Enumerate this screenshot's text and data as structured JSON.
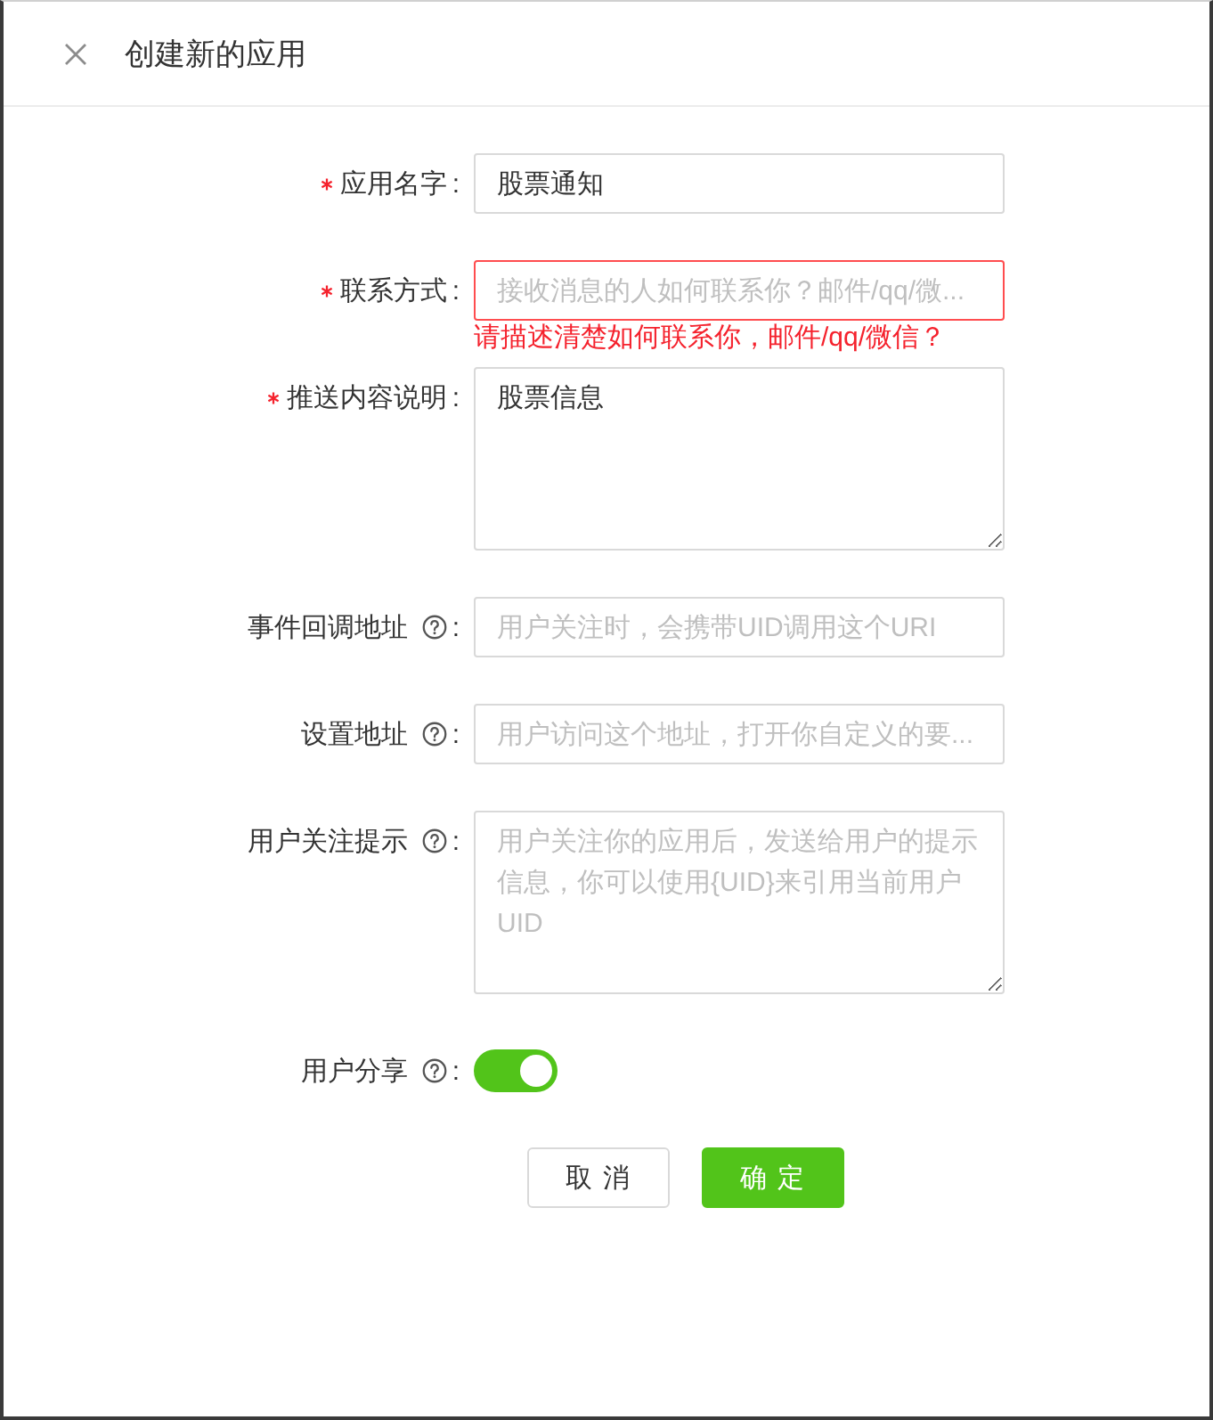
{
  "dialog": {
    "title": "创建新的应用"
  },
  "fields": [
    {
      "kind": "input",
      "label": "应用名字",
      "colon": ":",
      "required": true,
      "help": false,
      "value": "股票通知"
    },
    {
      "kind": "input",
      "label": "联系方式",
      "colon": ":",
      "required": true,
      "help": false,
      "placeholder": "接收消息的人如何联系你？邮件/qq/微...",
      "error": "请描述清楚如何联系你，邮件/qq/微信？"
    },
    {
      "kind": "textarea",
      "label": "推送内容说明",
      "colon": ":",
      "required": true,
      "help": false,
      "value": "股票信息"
    },
    {
      "kind": "input",
      "label": "事件回调地址",
      "colon": ":",
      "required": false,
      "help": true,
      "placeholder": "用户关注时，会携带UID调用这个URI"
    },
    {
      "kind": "input",
      "label": "设置地址",
      "colon": ":",
      "required": false,
      "help": true,
      "placeholder": "用户访问这个地址，打开你自定义的要..."
    },
    {
      "kind": "textarea",
      "label": "用户关注提示",
      "colon": ":",
      "required": false,
      "help": true,
      "placeholder": "用户关注你的应用后，发送给用户的提示信息，你可以使用{UID}来引用当前用户UID"
    },
    {
      "kind": "switch",
      "label": "用户分享",
      "colon": ":",
      "required": false,
      "help": true,
      "on": true
    }
  ],
  "buttons": [
    {
      "label": "取 消",
      "kind": "default"
    },
    {
      "label": "确 定",
      "kind": "primary"
    }
  ]
}
